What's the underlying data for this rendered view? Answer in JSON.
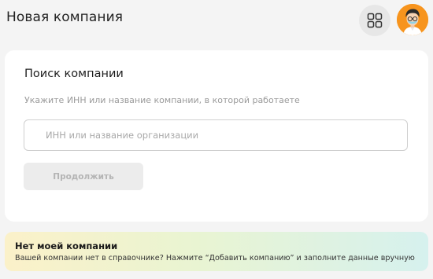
{
  "header": {
    "title": "Новая компания",
    "apps_icon": "grid-apps-icon",
    "avatar_icon": "user-avatar",
    "avatar_bg": "#f7941d"
  },
  "search_card": {
    "title": "Поиск компании",
    "hint": "Укажите ИНН или название компании, в которой работаете",
    "input": {
      "value": "",
      "placeholder": "ИНН или название организации"
    },
    "continue_label": "Продолжить",
    "continue_enabled": false
  },
  "banner": {
    "title": "Нет моей компании",
    "text": "Вашей компании нет в справочнике? Нажмите “Добавить компанию” и заполните данные вручную"
  }
}
